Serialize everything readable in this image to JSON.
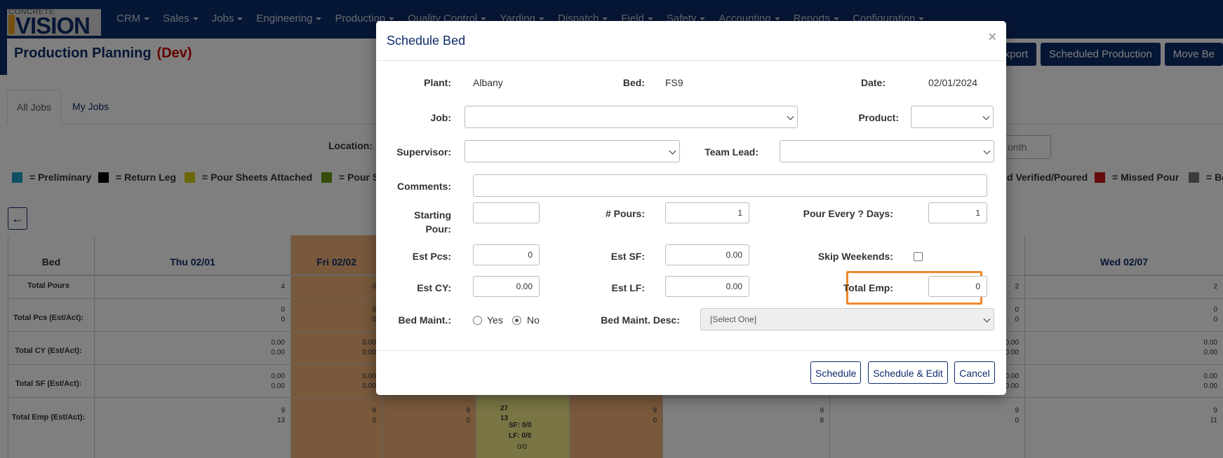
{
  "logo": {
    "small": "CONCRETE",
    "big": "VISION"
  },
  "nav": [
    {
      "label": "CRM"
    },
    {
      "label": "Sales"
    },
    {
      "label": "Jobs"
    },
    {
      "label": "Engineering"
    },
    {
      "label": "Production"
    },
    {
      "label": "Quality Control"
    },
    {
      "label": "Yarding"
    },
    {
      "label": "Dispatch"
    },
    {
      "label": "Field"
    },
    {
      "label": "Safety"
    },
    {
      "label": "Accounting"
    },
    {
      "label": "Reports"
    },
    {
      "label": "Configuration"
    }
  ],
  "page": {
    "title": "Production Planning",
    "env": "(Dev)"
  },
  "top_buttons": {
    "export": "Export",
    "scheduled": "Scheduled Production",
    "move": "Move Be"
  },
  "tabs": {
    "all_jobs": "All Jobs",
    "my_jobs": "My Jobs"
  },
  "filters": {
    "location_label": "Location:",
    "month_value": "onth"
  },
  "legend": {
    "preliminary": "= Preliminary",
    "return_leg": "= Return Leg",
    "pour_sheets": "= Pour Sheets Attached",
    "pour_s": "= Pour S",
    "verified": "d Verified/Poured",
    "missed": "= Missed Pour",
    "bed": "= Be",
    "colors": {
      "preliminary": "#1ba1c9",
      "return_leg": "#000000",
      "pour_sheets": "#d6cf10",
      "pour_s": "#6a9a10",
      "missed": "#c81414",
      "bed": "#777777"
    }
  },
  "back_icon": "arrow-left-icon",
  "grid": {
    "bed_header": "Bed",
    "day_headers": {
      "thu": "Thu 02/01",
      "fri": "Fri 02/02",
      "wed": "Wed 02/07"
    },
    "row_labels": {
      "pours": "Total Pours",
      "pcs": "Total Pcs (Est/Act):",
      "cy": "Total CY (Est/Act):",
      "sf": "Total SF (Est/Act):",
      "emp": "Total Emp (Est/Act):"
    },
    "thu": {
      "pours": "4",
      "pcs1": "0",
      "pcs2": "0",
      "cy1": "0.00",
      "cy2": "0.00",
      "sf1": "0.00",
      "sf2": "0.00",
      "emp1": "9",
      "emp2": "13"
    },
    "fri": {
      "pours": "0",
      "pcs1": "0",
      "pcs2": "0",
      "cy1": "0.00",
      "cy2": "0.00",
      "sf1": "0.00",
      "sf2": "0.00",
      "emp1": "9",
      "emp2": "0"
    },
    "sat": {
      "emp1": "9",
      "emp2": "0"
    },
    "sun": {
      "emp1": "27",
      "emp2": "13",
      "sf": "SF: 0/0",
      "lf": "LF: 0/0",
      "extra": "0/0"
    },
    "mon": {
      "emp1": "9",
      "emp2": "0"
    },
    "tue1": {
      "emp1": "9",
      "emp2": "8"
    },
    "tue2": {
      "pours": "2",
      "pcs1": "0",
      "pcs2": "0",
      "cy1": "0.00",
      "cy2": "0.00",
      "sf1": "0.00",
      "sf2": "0.00",
      "emp1": "9",
      "emp2": "0"
    },
    "wed": {
      "pours": "2",
      "pcs1": "0",
      "pcs2": "0",
      "cy1": "0.00",
      "cy2": "0.00",
      "sf1": "0.00",
      "sf2": "0.00",
      "emp1": "9",
      "emp2": "11"
    }
  },
  "modal": {
    "title": "Schedule Bed",
    "close": "×",
    "plant_label": "Plant:",
    "plant_value": "Albany",
    "bed_label": "Bed:",
    "bed_value": "FS9",
    "date_label": "Date:",
    "date_value": "02/01/2024",
    "job_label": "Job:",
    "product_label": "Product:",
    "supervisor_label": "Supervisor:",
    "team_lead_label": "Team Lead:",
    "comments_label": "Comments:",
    "starting_pour_label": "Starting Pour:",
    "pours_label": "# Pours:",
    "pours_value": "1",
    "pour_every_label": "Pour Every ? Days:",
    "pour_every_value": "1",
    "est_pcs_label": "Est Pcs:",
    "est_pcs_value": "0",
    "est_sf_label": "Est SF:",
    "est_sf_value": "0.00",
    "skip_weekends_label": "Skip Weekends:",
    "est_cy_label": "Est CY:",
    "est_cy_value": "0.00",
    "est_lf_label": "Est LF:",
    "est_lf_value": "0.00",
    "total_emp_label": "Total Emp:",
    "total_emp_value": "0",
    "bed_maint_label": "Bed Maint.:",
    "yes_label": "Yes",
    "no_label": "No",
    "bed_maint_desc_label": "Bed Maint. Desc:",
    "bed_maint_desc_value": "[Select One]",
    "schedule_btn": "Schedule",
    "schedule_edit_btn": "Schedule & Edit",
    "cancel_btn": "Cancel"
  }
}
